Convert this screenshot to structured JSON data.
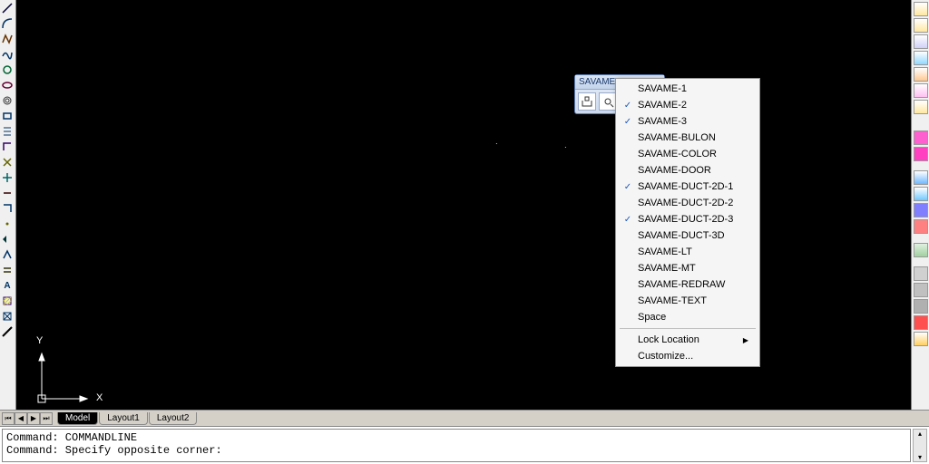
{
  "floating_toolbar": {
    "title": "SAVAME",
    "buttons": [
      "⎕",
      "⊙"
    ]
  },
  "context_menu": {
    "items": [
      {
        "label": "SAVAME-1",
        "checked": false
      },
      {
        "label": "SAVAME-2",
        "checked": true
      },
      {
        "label": "SAVAME-3",
        "checked": true
      },
      {
        "label": "SAVAME-BULON",
        "checked": false
      },
      {
        "label": "SAVAME-COLOR",
        "checked": false
      },
      {
        "label": "SAVAME-DOOR",
        "checked": false
      },
      {
        "label": "SAVAME-DUCT-2D-1",
        "checked": true
      },
      {
        "label": "SAVAME-DUCT-2D-2",
        "checked": false
      },
      {
        "label": "SAVAME-DUCT-2D-3",
        "checked": true
      },
      {
        "label": "SAVAME-DUCT-3D",
        "checked": false
      },
      {
        "label": "SAVAME-LT",
        "checked": false
      },
      {
        "label": "SAVAME-MT",
        "checked": false
      },
      {
        "label": "SAVAME-REDRAW",
        "checked": false
      },
      {
        "label": "SAVAME-TEXT",
        "checked": false
      },
      {
        "label": "Space",
        "checked": false
      }
    ],
    "footer": [
      {
        "label": "Lock Location",
        "submenu": true
      },
      {
        "label": "Customize...",
        "submenu": false
      }
    ]
  },
  "tabs": {
    "active": "Model",
    "items": [
      "Model",
      "Layout1",
      "Layout2"
    ]
  },
  "ucs": {
    "x_label": "X",
    "y_label": "Y"
  },
  "command": {
    "line1": "Command: COMMANDLINE",
    "line2": "Command: Specify opposite corner:"
  },
  "left_tool_colors": [
    "#003",
    "#036",
    "#630",
    "#036",
    "#063",
    "#603",
    "#333",
    "#036",
    "#036",
    "#306",
    "#660",
    "#066",
    "#300",
    "#036",
    "#660",
    "#033",
    "#036",
    "#330",
    "#036",
    "#306",
    "#036",
    "#660",
    "#036"
  ],
  "right_tool_colors": [
    "#ffe070",
    "#ffe070",
    "#e0e0ff",
    "#70c8ff",
    "#ffb870",
    "#ffb0f0",
    "#ffe070",
    "#ff90e0",
    "#ff70e0",
    "#ff70c8",
    "#70b8ff",
    "#70c8ff",
    "#9090ff",
    "#ff9090",
    "#b8e0b8",
    "#d0d0d0",
    "#c0c0c0",
    "#b8b8b8",
    "#ff6060",
    "#ffd060"
  ]
}
